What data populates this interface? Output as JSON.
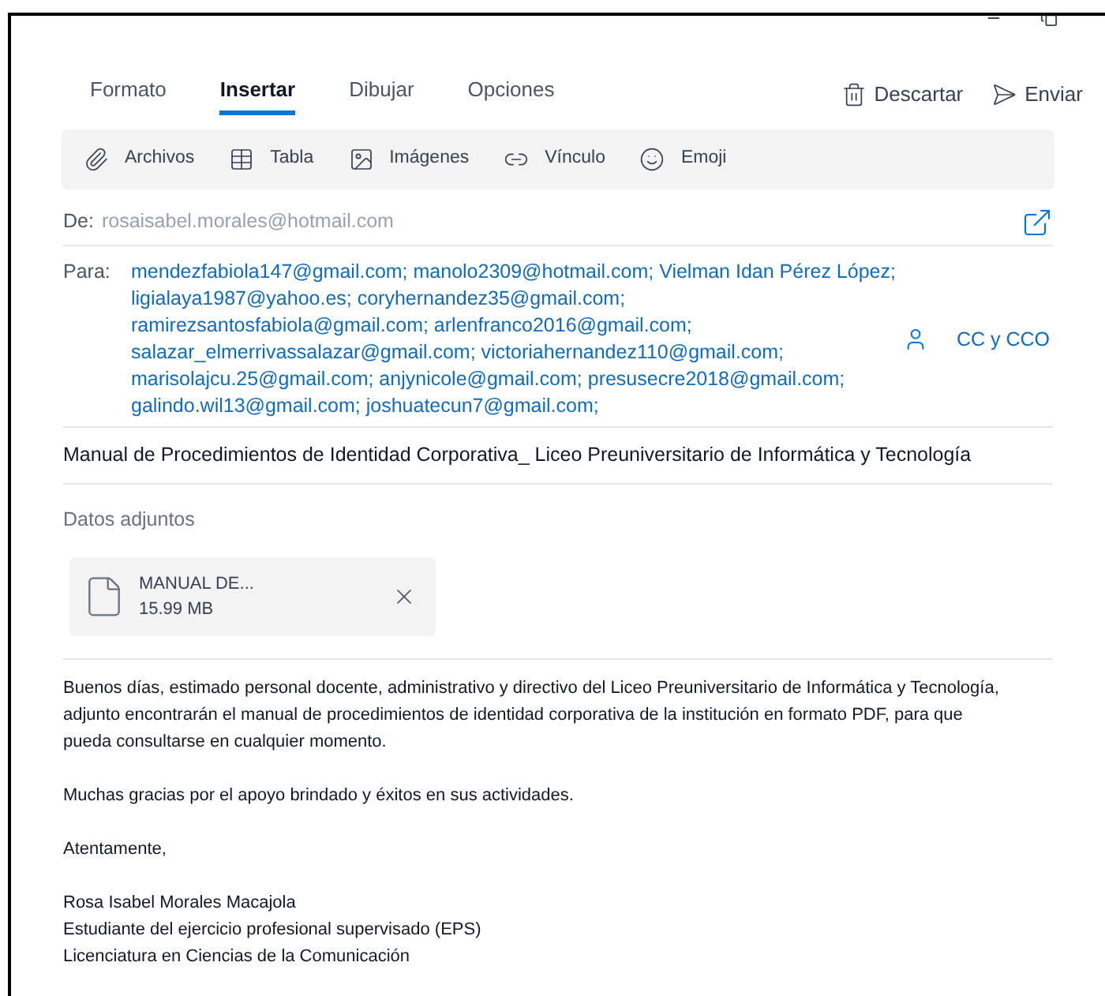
{
  "window": {
    "controls": [
      {
        "kind": "minimize"
      },
      {
        "kind": "restore"
      }
    ]
  },
  "tabs": [
    {
      "label": "Formato",
      "selected": false
    },
    {
      "label": "Insertar",
      "selected": true
    },
    {
      "label": "Dibujar",
      "selected": false
    },
    {
      "label": "Opciones",
      "selected": false
    }
  ],
  "actions": [
    {
      "kind": "discard",
      "label": "Descartar"
    },
    {
      "kind": "send",
      "label": "Enviar"
    }
  ],
  "toolbar": [
    {
      "kind": "attach",
      "label": "Archivos"
    },
    {
      "kind": "table",
      "label": "Tabla"
    },
    {
      "kind": "image",
      "label": "Imágenes"
    },
    {
      "kind": "link",
      "label": "Vínculo"
    },
    {
      "kind": "emoji",
      "label": "Emoji"
    }
  ],
  "from": {
    "label": "De:",
    "value": "rosaisabel.morales@hotmail.com"
  },
  "to": {
    "label": "Para:",
    "lines": [
      "mendezfabiola147@gmail.com; manolo2309@hotmail.com; Vielman Idan Pérez López;",
      "ligialaya1987@yahoo.es; coryhernandez35@gmail.com;",
      "ramirezsantosfabiola@gmail.com; arlenfranco2016@gmail.com;",
      "salazar_elmerrivassalazar@gmail.com; victoriahernandez110@gmail.com;",
      "marisolajcu.25@gmail.com; anjynicole@gmail.com; presusecre2018@gmail.com;",
      "galindo.wil13@gmail.com; joshuatecun7@gmail.com;"
    ],
    "cc_button": "CC y CCO"
  },
  "subject": "Manual de Procedimientos de Identidad Corporativa_ Liceo Preuniversitario de Informática y Tecnología",
  "attachments": {
    "title": "Datos adjuntos",
    "files": [
      {
        "name": "MANUAL DE...",
        "size": "15.99 MB"
      }
    ]
  },
  "body": [
    [
      "Buenos días, estimado personal docente, administrativo y directivo del Liceo Preuniversitario de Informática y Tecnología,",
      "adjunto encontrarán el manual de procedimientos de identidad corporativa de la institución en formato PDF, para que",
      "pueda consultarse en cualquier momento."
    ],
    [
      "Muchas gracias por el apoyo brindado y éxitos en sus actividades."
    ],
    [
      "Atentamente,"
    ],
    [
      "Rosa Isabel Morales Macajola",
      "Estudiante del ejercicio profesional supervisado (EPS)",
      "Licenciatura en Ciencias de la Comunicación"
    ]
  ]
}
